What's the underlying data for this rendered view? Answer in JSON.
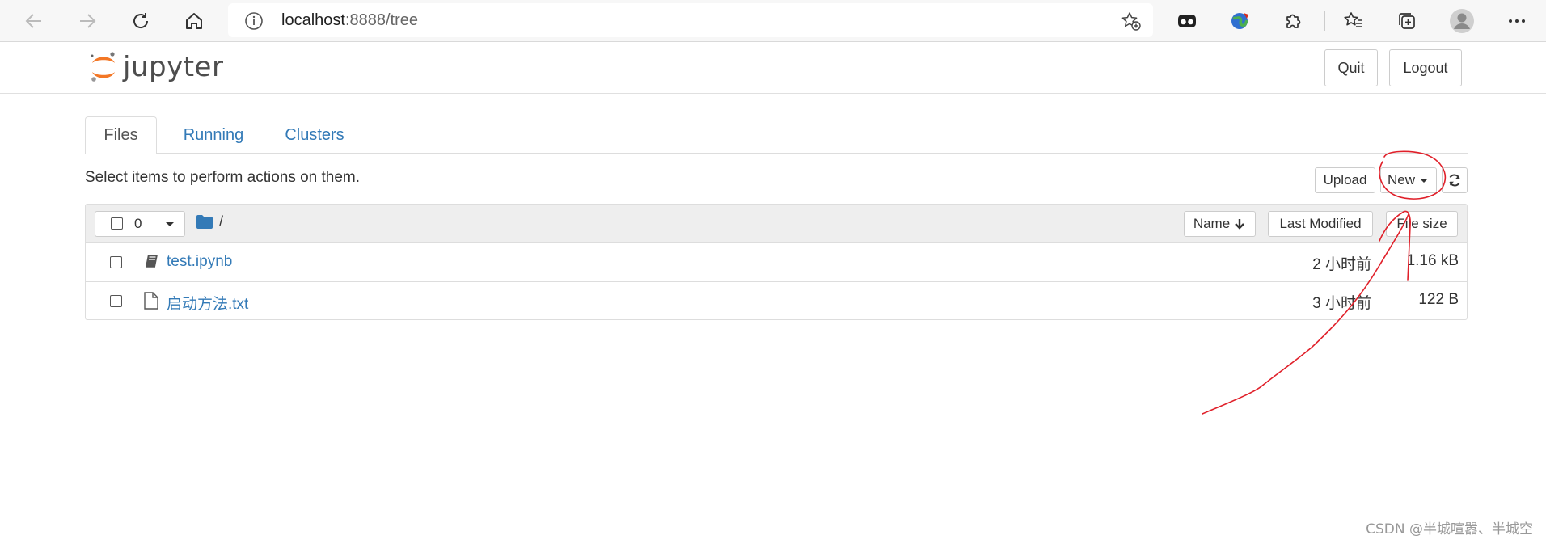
{
  "browser": {
    "address": {
      "host": "localhost",
      "rest": ":8888/tree"
    },
    "icons": [
      "back-icon",
      "forward-icon",
      "reload-icon",
      "home-icon",
      "info-icon",
      "add-favorite-icon",
      "extension-icons",
      "puzzle-icon",
      "favorites-icon",
      "collections-icon",
      "profile-icon",
      "more-icon"
    ]
  },
  "header": {
    "logo_text": "jupyter",
    "quit_label": "Quit",
    "logout_label": "Logout"
  },
  "tabs": [
    {
      "label": "Files",
      "active": true
    },
    {
      "label": "Running",
      "active": false
    },
    {
      "label": "Clusters",
      "active": false
    }
  ],
  "toolbar": {
    "hint": "Select items to perform actions on them.",
    "upload_label": "Upload",
    "new_label": "New",
    "refresh_icon": "refresh-icon"
  },
  "list_header": {
    "selected_count": "0",
    "breadcrumb": "/",
    "sort_name_label": "Name",
    "sort_modified_label": "Last Modified",
    "sort_size_label": "File size"
  },
  "files": [
    {
      "name": "test.ipynb",
      "modified": "2 小时前",
      "size": "1.16 kB",
      "icon": "notebook-icon"
    },
    {
      "name": "启动方法.txt",
      "modified": "3 小时前",
      "size": "122 B",
      "icon": "file-icon"
    }
  ],
  "watermark": "CSDN @半城喧嚣、半城空",
  "colors": {
    "link": "#337ab7",
    "annotation": "#e0202a",
    "jupyter_orange": "#f37726"
  }
}
